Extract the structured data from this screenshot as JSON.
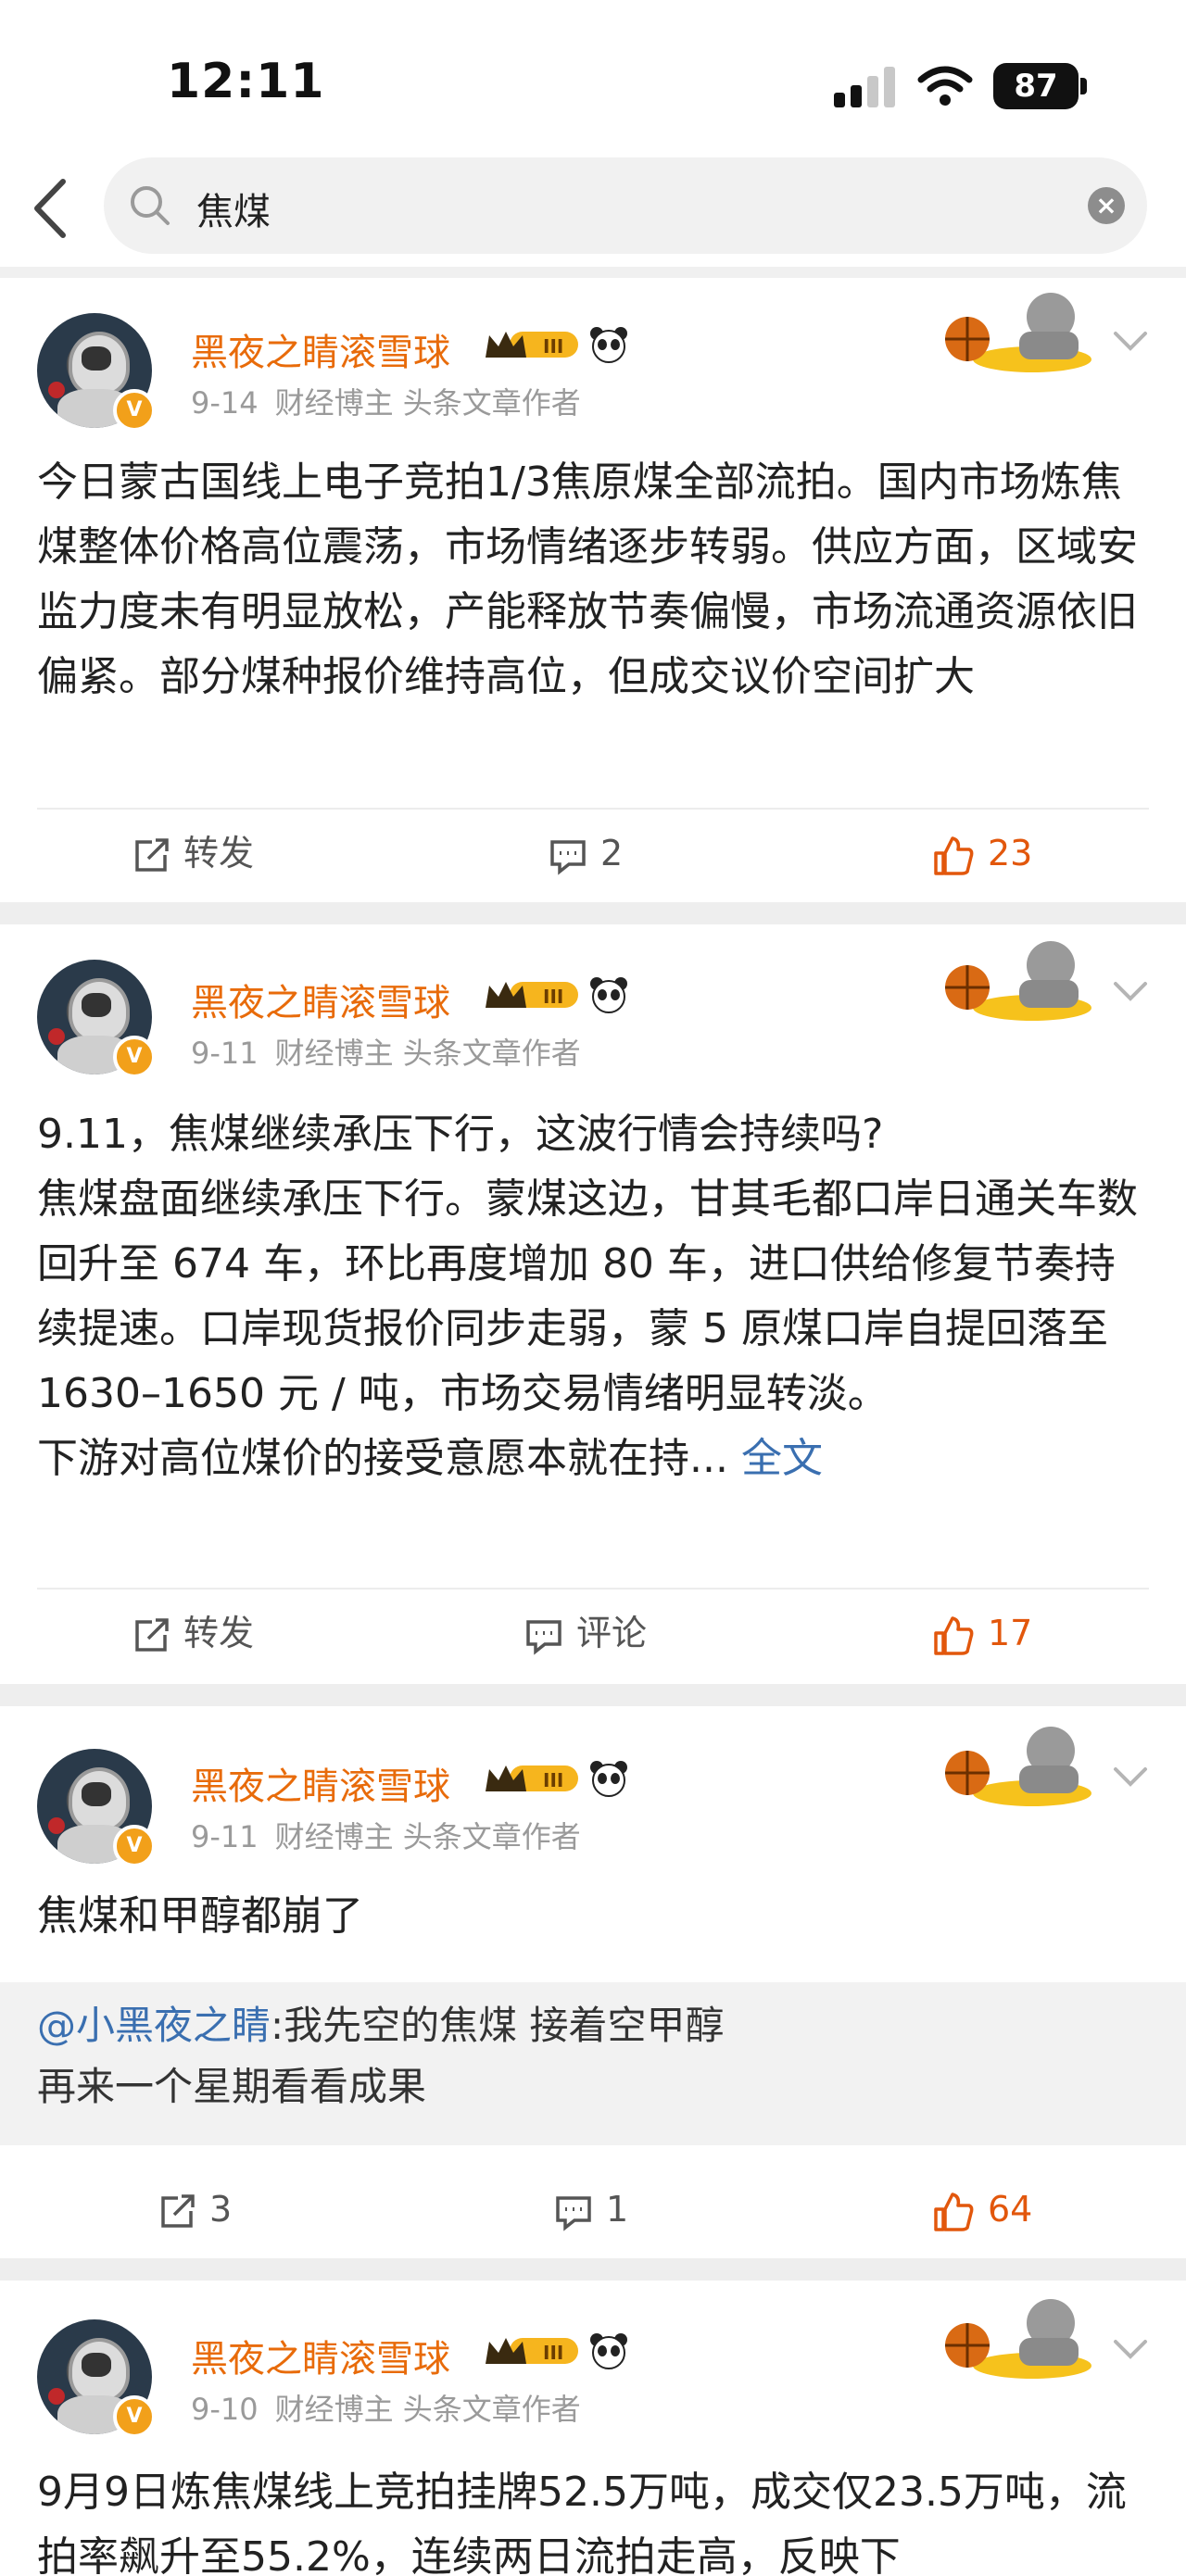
{
  "status": {
    "time": "12:11",
    "battery": "87"
  },
  "search": {
    "query": "焦煤"
  },
  "posts": [
    {
      "author": "黑夜之睛滚雪球",
      "level": "III",
      "date": "9-14",
      "tags": "财经博主 头条文章作者",
      "text": "今日蒙古国线上电子竞拍1/3焦原煤全部流拍。国内市场炼焦煤整体价格高位震荡，市场情绪逐步转弱。供应方面，区域安监力度未有明显放松，产能释放节奏偏慢，市场流通资源依旧偏紧。部分煤种报价维持高位，但成交议价空间扩大",
      "more": "",
      "repost": "转发",
      "comment": "2",
      "like": "23"
    },
    {
      "author": "黑夜之睛滚雪球",
      "level": "III",
      "date": "9-11",
      "tags": "财经博主 头条文章作者",
      "text_lines": [
        "9.11，焦煤继续承压下行，这波行情会持续吗?",
        "焦煤盘面继续承压下行。蒙煤这边，甘其毛都口岸日通关车数回升至 674 车，环比再度增加 80 车，进口供给修复节奏持续提速。口岸现货报价同步走弱，蒙 5 原煤口岸自提回落至 1630–1650 元 / 吨，市场交易情绪明显转淡。",
        "下游对高位煤价的接受意愿本就在持..."
      ],
      "more": "全文",
      "repost": "转发",
      "comment": "评论",
      "like": "17"
    },
    {
      "author": "黑夜之睛滚雪球",
      "level": "III",
      "date": "9-11",
      "tags": "财经博主 头条文章作者",
      "text": "焦煤和甲醇都崩了",
      "quote_user": "@小黑夜之睛",
      "quote_text": ":我先空的焦煤 接着空甲醇",
      "quote_text2": "再来一个星期看看成果",
      "repost": "3",
      "comment": "1",
      "like": "64"
    },
    {
      "author": "黑夜之睛滚雪球",
      "level": "III",
      "date": "9-10",
      "tags": "财经博主 头条文章作者",
      "text": "9月9日炼焦煤线上竞拍挂牌52.5万吨，成交仅23.5万吨，流拍率飙升至55.2%，连续两日流拍走高，反映下"
    }
  ]
}
